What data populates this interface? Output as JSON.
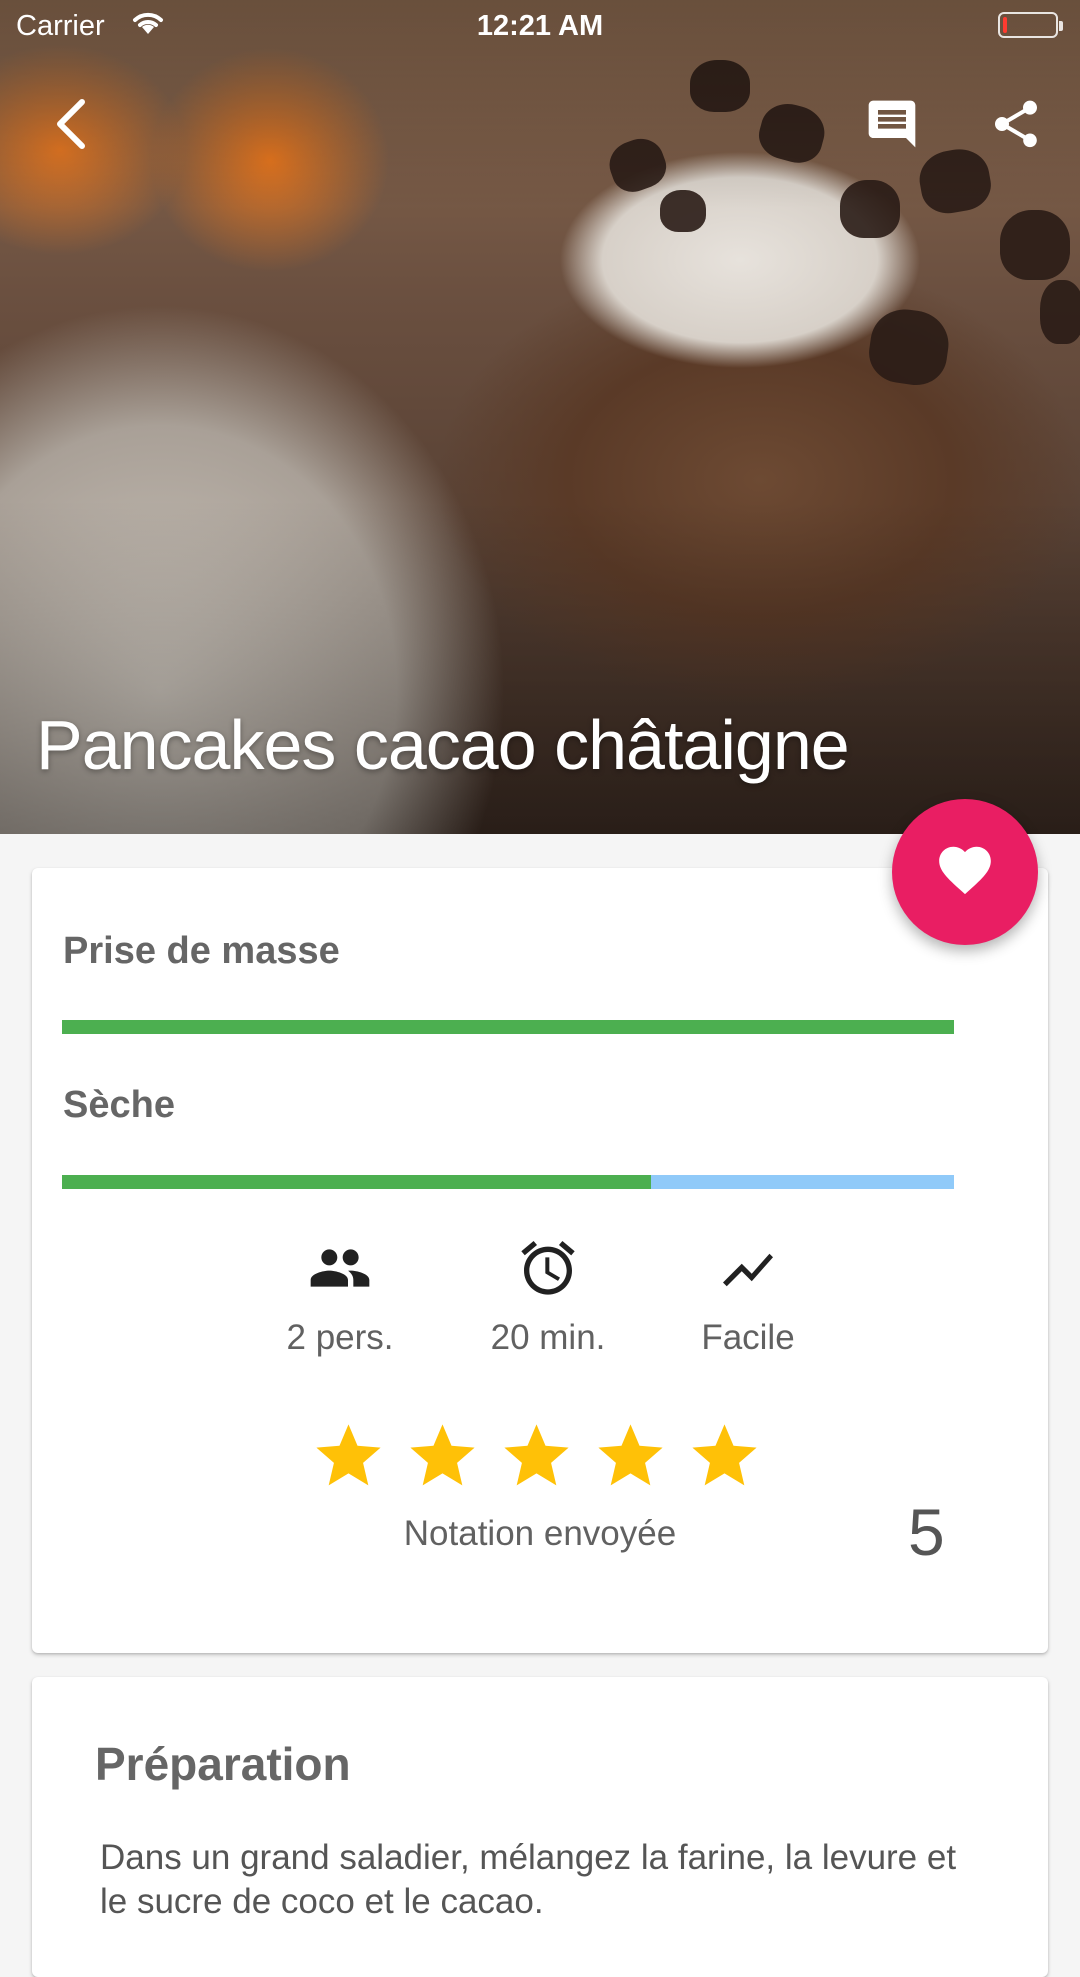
{
  "status_bar": {
    "carrier": "Carrier",
    "time": "12:21 AM",
    "icons": [
      "wifi-icon",
      "battery-icon"
    ]
  },
  "app_bar": {
    "icons": [
      "arrow-back-icon",
      "comment-icon",
      "share-icon"
    ]
  },
  "recipe": {
    "title": "Pancakes cacao châtaigne"
  },
  "goals": [
    {
      "label": "Prise de masse",
      "value": 1.0
    },
    {
      "label": "Sèche",
      "value": 0.66
    }
  ],
  "info": {
    "people": "2 pers.",
    "time": "20 min.",
    "difficulty": "Facile",
    "icons": [
      "people-icon",
      "alarm-icon",
      "trending-icon"
    ]
  },
  "rating": {
    "stars": 5,
    "max_stars": 5,
    "caption": "Notation envoyée",
    "value": "5"
  },
  "favorite": {
    "icon": "heart-icon"
  },
  "preparation": {
    "title": "Préparation",
    "text": "Dans un grand saladier, mélangez la farine, la levure et le sucre de coco et le cacao."
  },
  "colors": {
    "accent": "#e91e63",
    "bar_fill": "#4caf50",
    "bar_track": "#90caf9",
    "star": "#ffc107"
  }
}
